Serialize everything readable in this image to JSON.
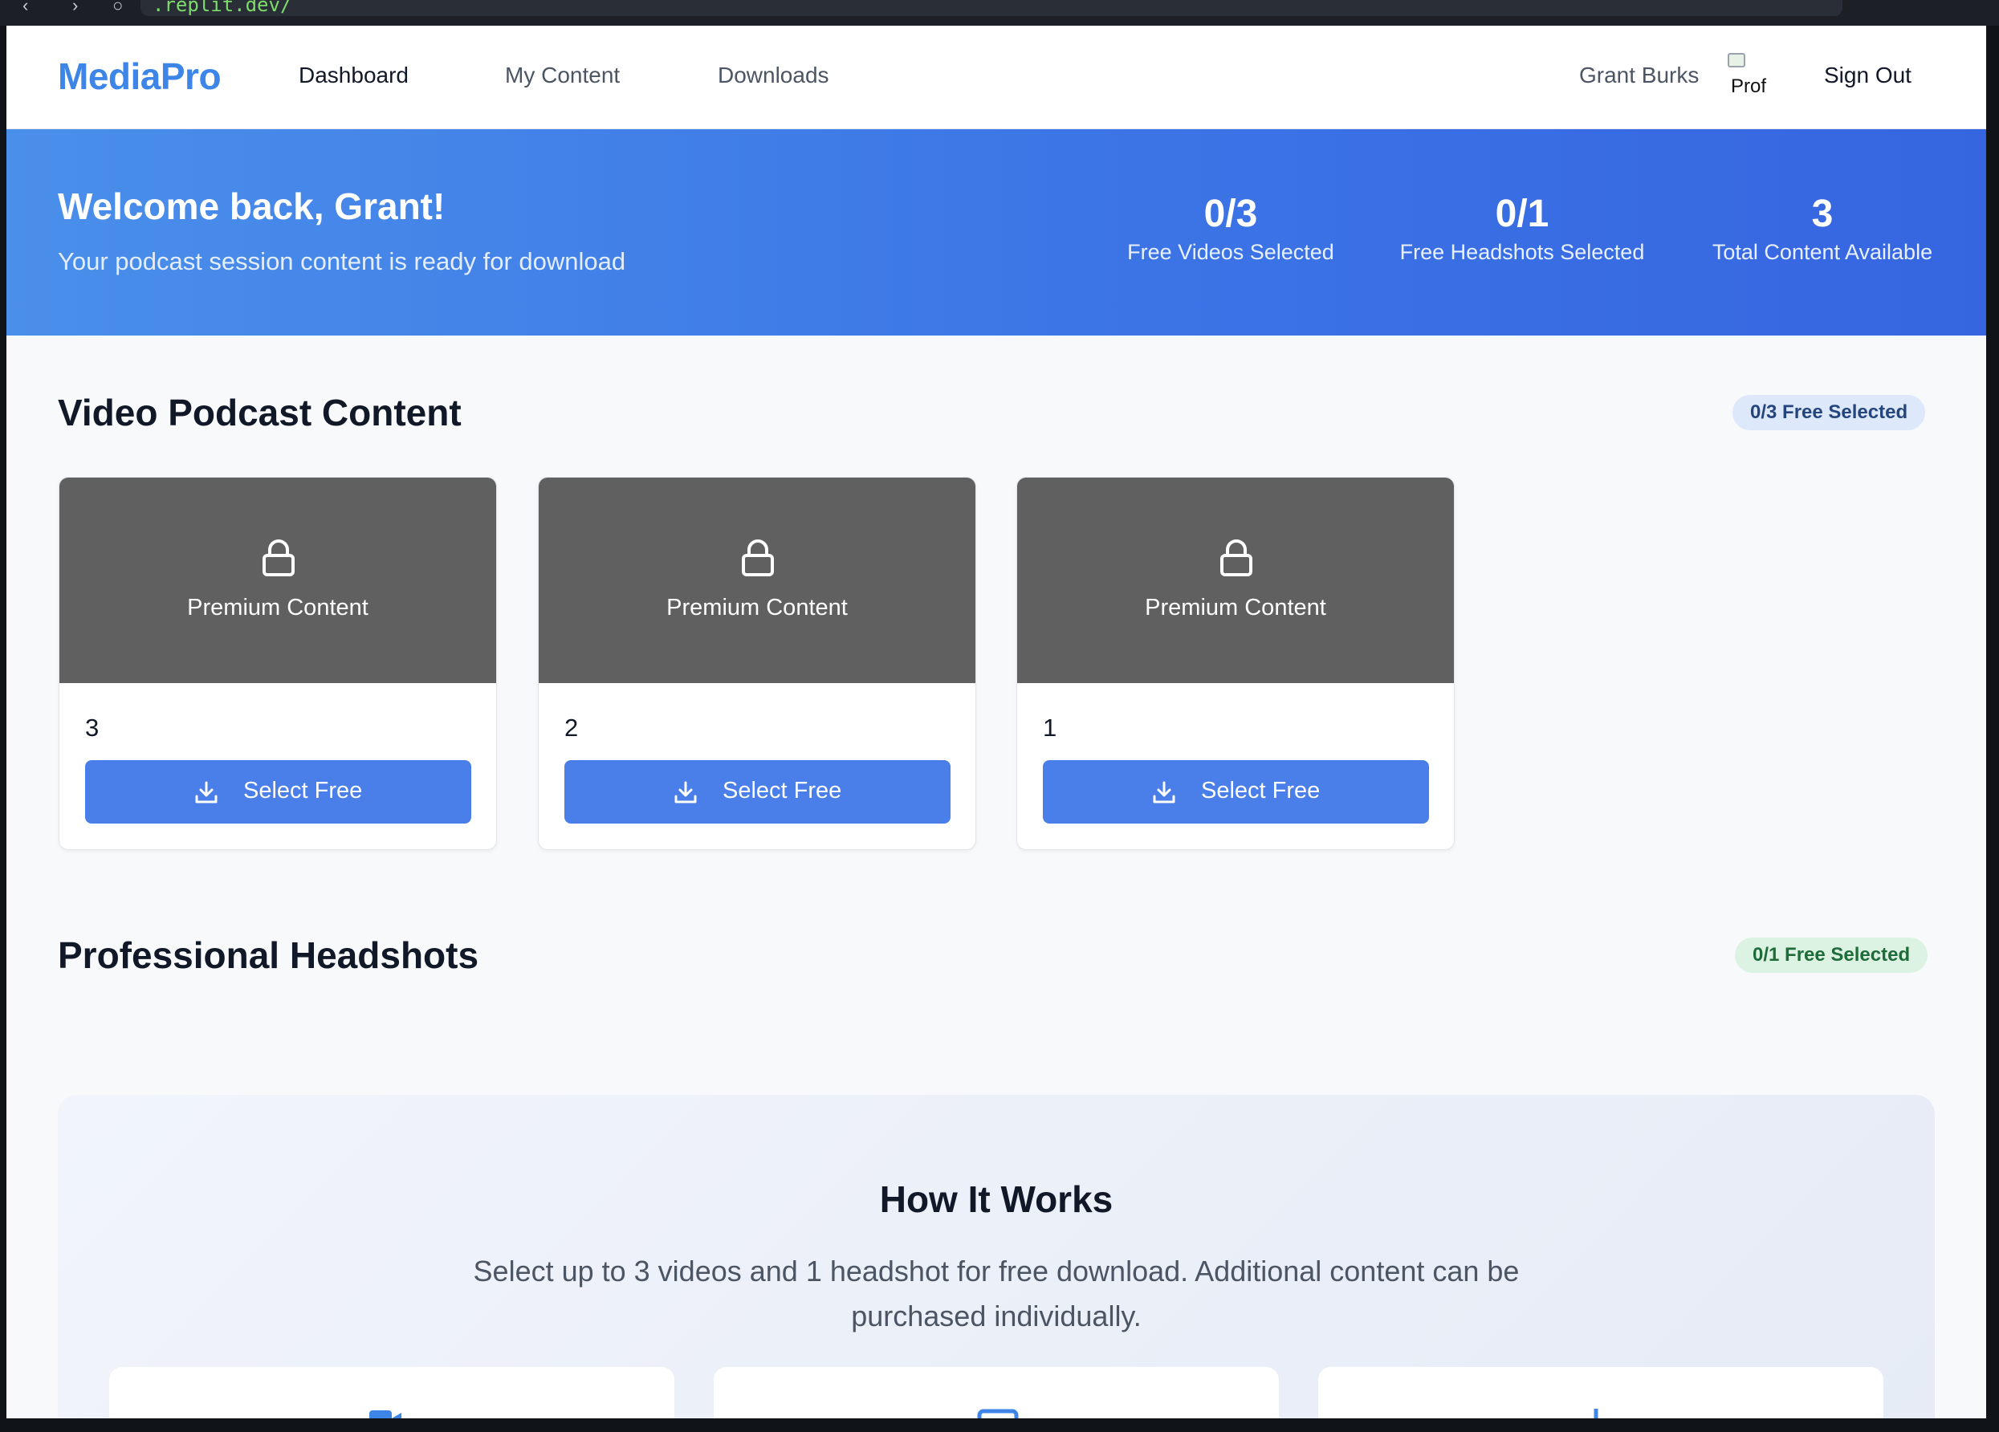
{
  "browser": {
    "url": ".replit.dev/"
  },
  "nav": {
    "brand": "MediaPro",
    "links": [
      "Dashboard",
      "My Content",
      "Downloads"
    ],
    "user_name": "Grant Burks",
    "avatar_alt": "Prof",
    "sign_out": "Sign Out"
  },
  "hero": {
    "title": "Welcome back, Grant!",
    "subtitle": "Your podcast session content is ready for download",
    "stats": [
      {
        "value": "0/3",
        "label": "Free Videos Selected"
      },
      {
        "value": "0/1",
        "label": "Free Headshots Selected"
      },
      {
        "value": "3",
        "label": "Total Content Available"
      }
    ]
  },
  "videos": {
    "title": "Video Podcast Content",
    "badge": "0/3 Free Selected",
    "items": [
      {
        "premium_label": "Premium Content",
        "title": "3",
        "button": "Select Free"
      },
      {
        "premium_label": "Premium Content",
        "title": "2",
        "button": "Select Free"
      },
      {
        "premium_label": "Premium Content",
        "title": "1",
        "button": "Select Free"
      }
    ]
  },
  "headshots": {
    "title": "Professional Headshots",
    "badge": "0/1 Free Selected"
  },
  "how_it_works": {
    "title": "How It Works",
    "description": "Select up to 3 videos and 1 headshot for free download. Additional content can be purchased individually."
  },
  "colors": {
    "brand": "#3d86e8",
    "hero_start": "#4a8fea",
    "hero_end": "#3665e0",
    "button": "#4a7ee8",
    "thumb": "#606060"
  }
}
